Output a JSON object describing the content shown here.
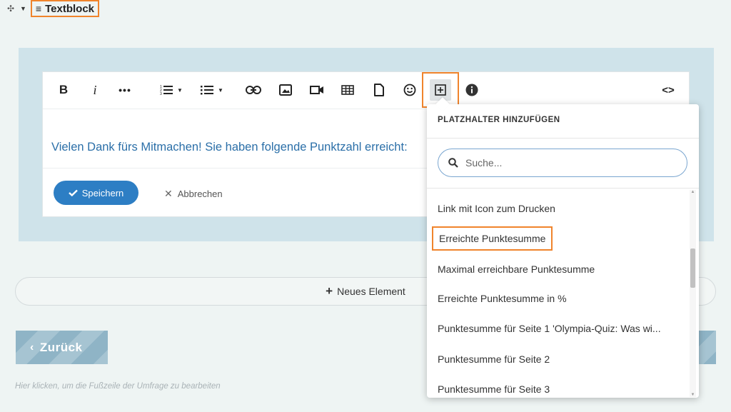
{
  "element_header": {
    "move_icon": "move-icon",
    "block_icon": "text-lines-icon",
    "block_label": "Textblock"
  },
  "editor": {
    "toolbar": {
      "bold": "B",
      "italic": "i",
      "more": "•••",
      "code": "<>"
    },
    "content_text": "Vielen Dank fürs Mitmachen! Sie haben folgende Punktzahl erreicht:",
    "save_label": "Speichern",
    "cancel_label": "Abbrechen"
  },
  "new_element_label": "Neues Element",
  "back_label": "Zurück",
  "footer_hint": "Hier klicken, um die Fußzeile der Umfrage zu bearbeiten",
  "placeholder_dropdown": {
    "title": "PLATZHALTER HINZUFÜGEN",
    "search_placeholder": "Suche...",
    "items": [
      "Link mit Icon zum Drucken",
      "Erreichte Punktesumme",
      "Maximal erreichbare Punktesumme",
      "Erreichte Punktesumme in %",
      "Punktesumme für Seite 1 'Olympia-Quiz: Was wi...",
      "Punktesumme für Seite 2",
      "Punktesumme für Seite 3"
    ],
    "highlighted_item": "Erreichte Punktesumme"
  },
  "colors": {
    "highlight": "#f0842c",
    "primary": "#2d7ec4",
    "link_text": "#2b6fa8",
    "panel": "#cfe3ea"
  }
}
